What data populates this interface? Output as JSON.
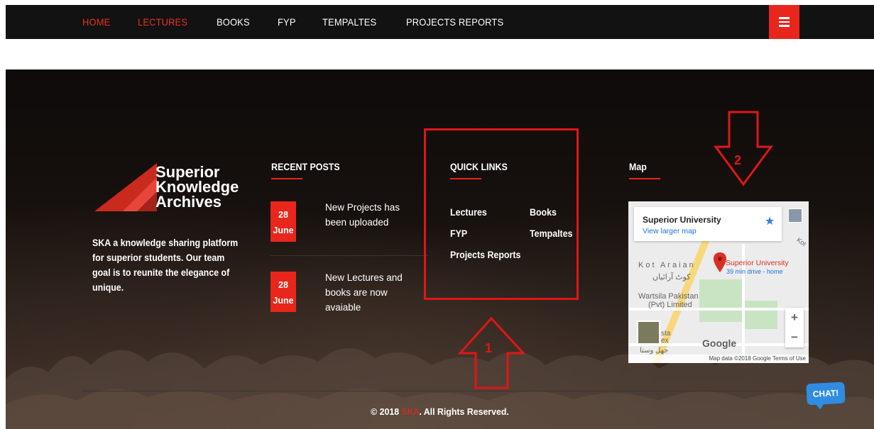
{
  "nav": {
    "items": [
      {
        "label": "HOME",
        "active": true
      },
      {
        "label": "LECTURES",
        "active": false
      },
      {
        "label": "BOOKS",
        "active": false
      },
      {
        "label": "FYP",
        "active": false
      },
      {
        "label": "TEMPALTES",
        "active": false
      },
      {
        "label": "PROJECTS REPORTS",
        "active": false
      }
    ],
    "menu_icon": "hamburger-icon"
  },
  "brand": {
    "name_line1": "Superior",
    "name_line2": "Knowledge",
    "name_line3": "Archives",
    "about": "SKA a knowledge sharing platform for superior students. Our team goal is to reunite the elegance of unique."
  },
  "recent_posts": {
    "title": "RECENT POSTS",
    "items": [
      {
        "day": "28",
        "month": "June",
        "text": "New Projects has been uploaded"
      },
      {
        "day": "28",
        "month": "June",
        "text": "New Lectures and books are now avaiable"
      }
    ]
  },
  "quick_links": {
    "title": "QUICK LINKS",
    "items": [
      "Lectures",
      "Books",
      "FYP",
      "Tempaltes",
      "Projects Reports"
    ]
  },
  "map": {
    "title": "Map",
    "place_title": "Superior University",
    "view_larger": "View larger map",
    "pin_label": "Superior University",
    "pin_sub": "39 min drive - home",
    "area_label_latin": "Kot Araian",
    "area_label_urdu": "کوٹ آرائیاں",
    "poi_label_line1": "Wartsila Pakistan",
    "poi_label_line2": "(Pvt) Limited",
    "edge_label_1": "Kot",
    "partial_label_1": "sta",
    "partial_label_2": "ex",
    "partial_label_urdu": "جھل وستا",
    "google": "Google",
    "footer": "Map data ©2018 Google   Terms of Use",
    "zoom_in": "+",
    "zoom_out": "−"
  },
  "footer": {
    "copyright_prefix": "© 2018 ",
    "copyright_brand": "SKA",
    "copyright_suffix": ". All Rights Reserved."
  },
  "chat": {
    "label": "CHAT!"
  },
  "annotations": {
    "one": "1",
    "two": "2"
  },
  "colors": {
    "accent": "#e8261b",
    "annotation": "#e01616",
    "nav_bg": "#121212"
  }
}
